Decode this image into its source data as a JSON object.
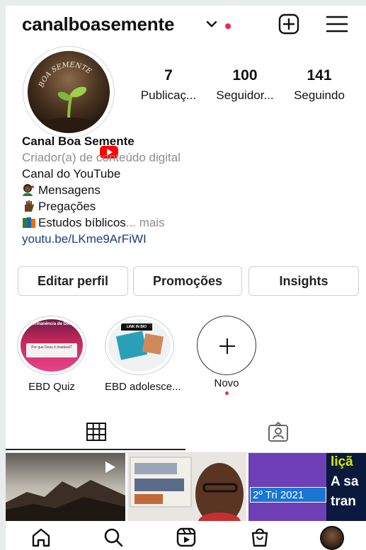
{
  "header": {
    "username": "canalboasemente",
    "icons": [
      "chevron-down-icon",
      "notification-dot",
      "add-post-icon",
      "hamburger-menu-icon"
    ]
  },
  "profile": {
    "avatar_text": "BOA SEMENTE",
    "stats": [
      {
        "value": "7",
        "label": "Publicaç..."
      },
      {
        "value": "100",
        "label": "Seguidor..."
      },
      {
        "value": "141",
        "label": "Seguindo"
      }
    ]
  },
  "bio": {
    "name": "Canal Boa Semente",
    "category": "Criador(a) de conteúdo digital",
    "line1": "Canal do YouTube",
    "line2": "Mensagens",
    "line3": "Pregações",
    "line4": "Estudos bíblicos",
    "more": "... mais",
    "link": "youtu.be/LKme9ArFiWI"
  },
  "buttons": {
    "edit": "Editar perfil",
    "promo": "Promoções",
    "insights": "Insights"
  },
  "highlights": [
    {
      "label": "EBD Quiz",
      "cover_title": "Permanência de Deus",
      "cover_question": "Por que Deus é imutável?"
    },
    {
      "label": "EBD adolesce...",
      "cover_title": "LINK IN BIO"
    },
    {
      "label": "Novo"
    }
  ],
  "posts": [
    {
      "kind": "video"
    },
    {
      "kind": "photo"
    },
    {
      "kind": "text",
      "text1": "liçã",
      "text2": "A sa",
      "text3": "tran",
      "tag": "2º Tri 2021"
    }
  ],
  "colors": {
    "accent_red": "#ed2a4b",
    "link": "#1b3f7a",
    "gray_text": "#8e8e8e"
  }
}
